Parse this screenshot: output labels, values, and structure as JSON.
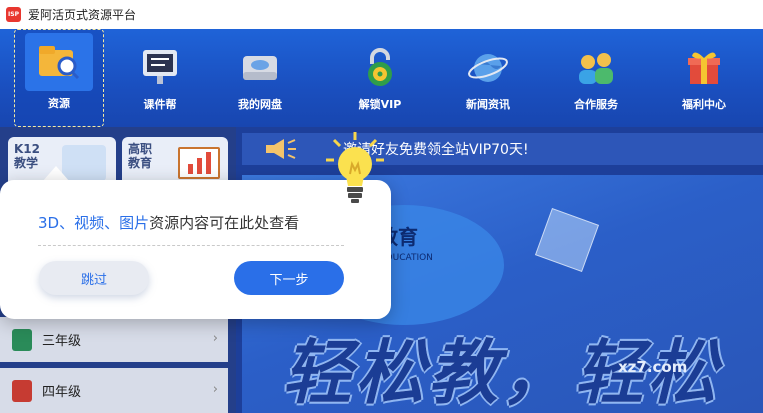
{
  "window": {
    "title": "爱阿活页式资源平台",
    "logo_text": "ISP"
  },
  "nav": {
    "items": [
      {
        "label": "资源",
        "icon": "folder-search-icon",
        "active": true
      },
      {
        "label": "课件帮",
        "icon": "presentation-board-icon"
      },
      {
        "label": "我的网盘",
        "icon": "cloud-drive-icon"
      },
      {
        "label": "解锁VIP",
        "icon": "padlock-icon"
      },
      {
        "label": "新闻资讯",
        "icon": "globe-icon"
      },
      {
        "label": "合作服务",
        "icon": "people-icon"
      },
      {
        "label": "福利中心",
        "icon": "gift-icon"
      }
    ]
  },
  "sidebar": {
    "cards": [
      {
        "label": "K12 教学"
      },
      {
        "label": "高职 教育"
      }
    ],
    "grades": [
      {
        "label": "三年级"
      },
      {
        "label": "四年级"
      }
    ]
  },
  "notice": {
    "text": "邀请好友免费领全站VIP70天!"
  },
  "banner": {
    "brand": "阿教育",
    "brand_en": "EDUCATION",
    "slogan": "轻松教，轻松"
  },
  "guide": {
    "highlight": "3D、视频、图片",
    "message": "资源内容可在此处查看",
    "skip_label": "跳过",
    "next_label": "下一步"
  },
  "watermark": "xz7.com"
}
